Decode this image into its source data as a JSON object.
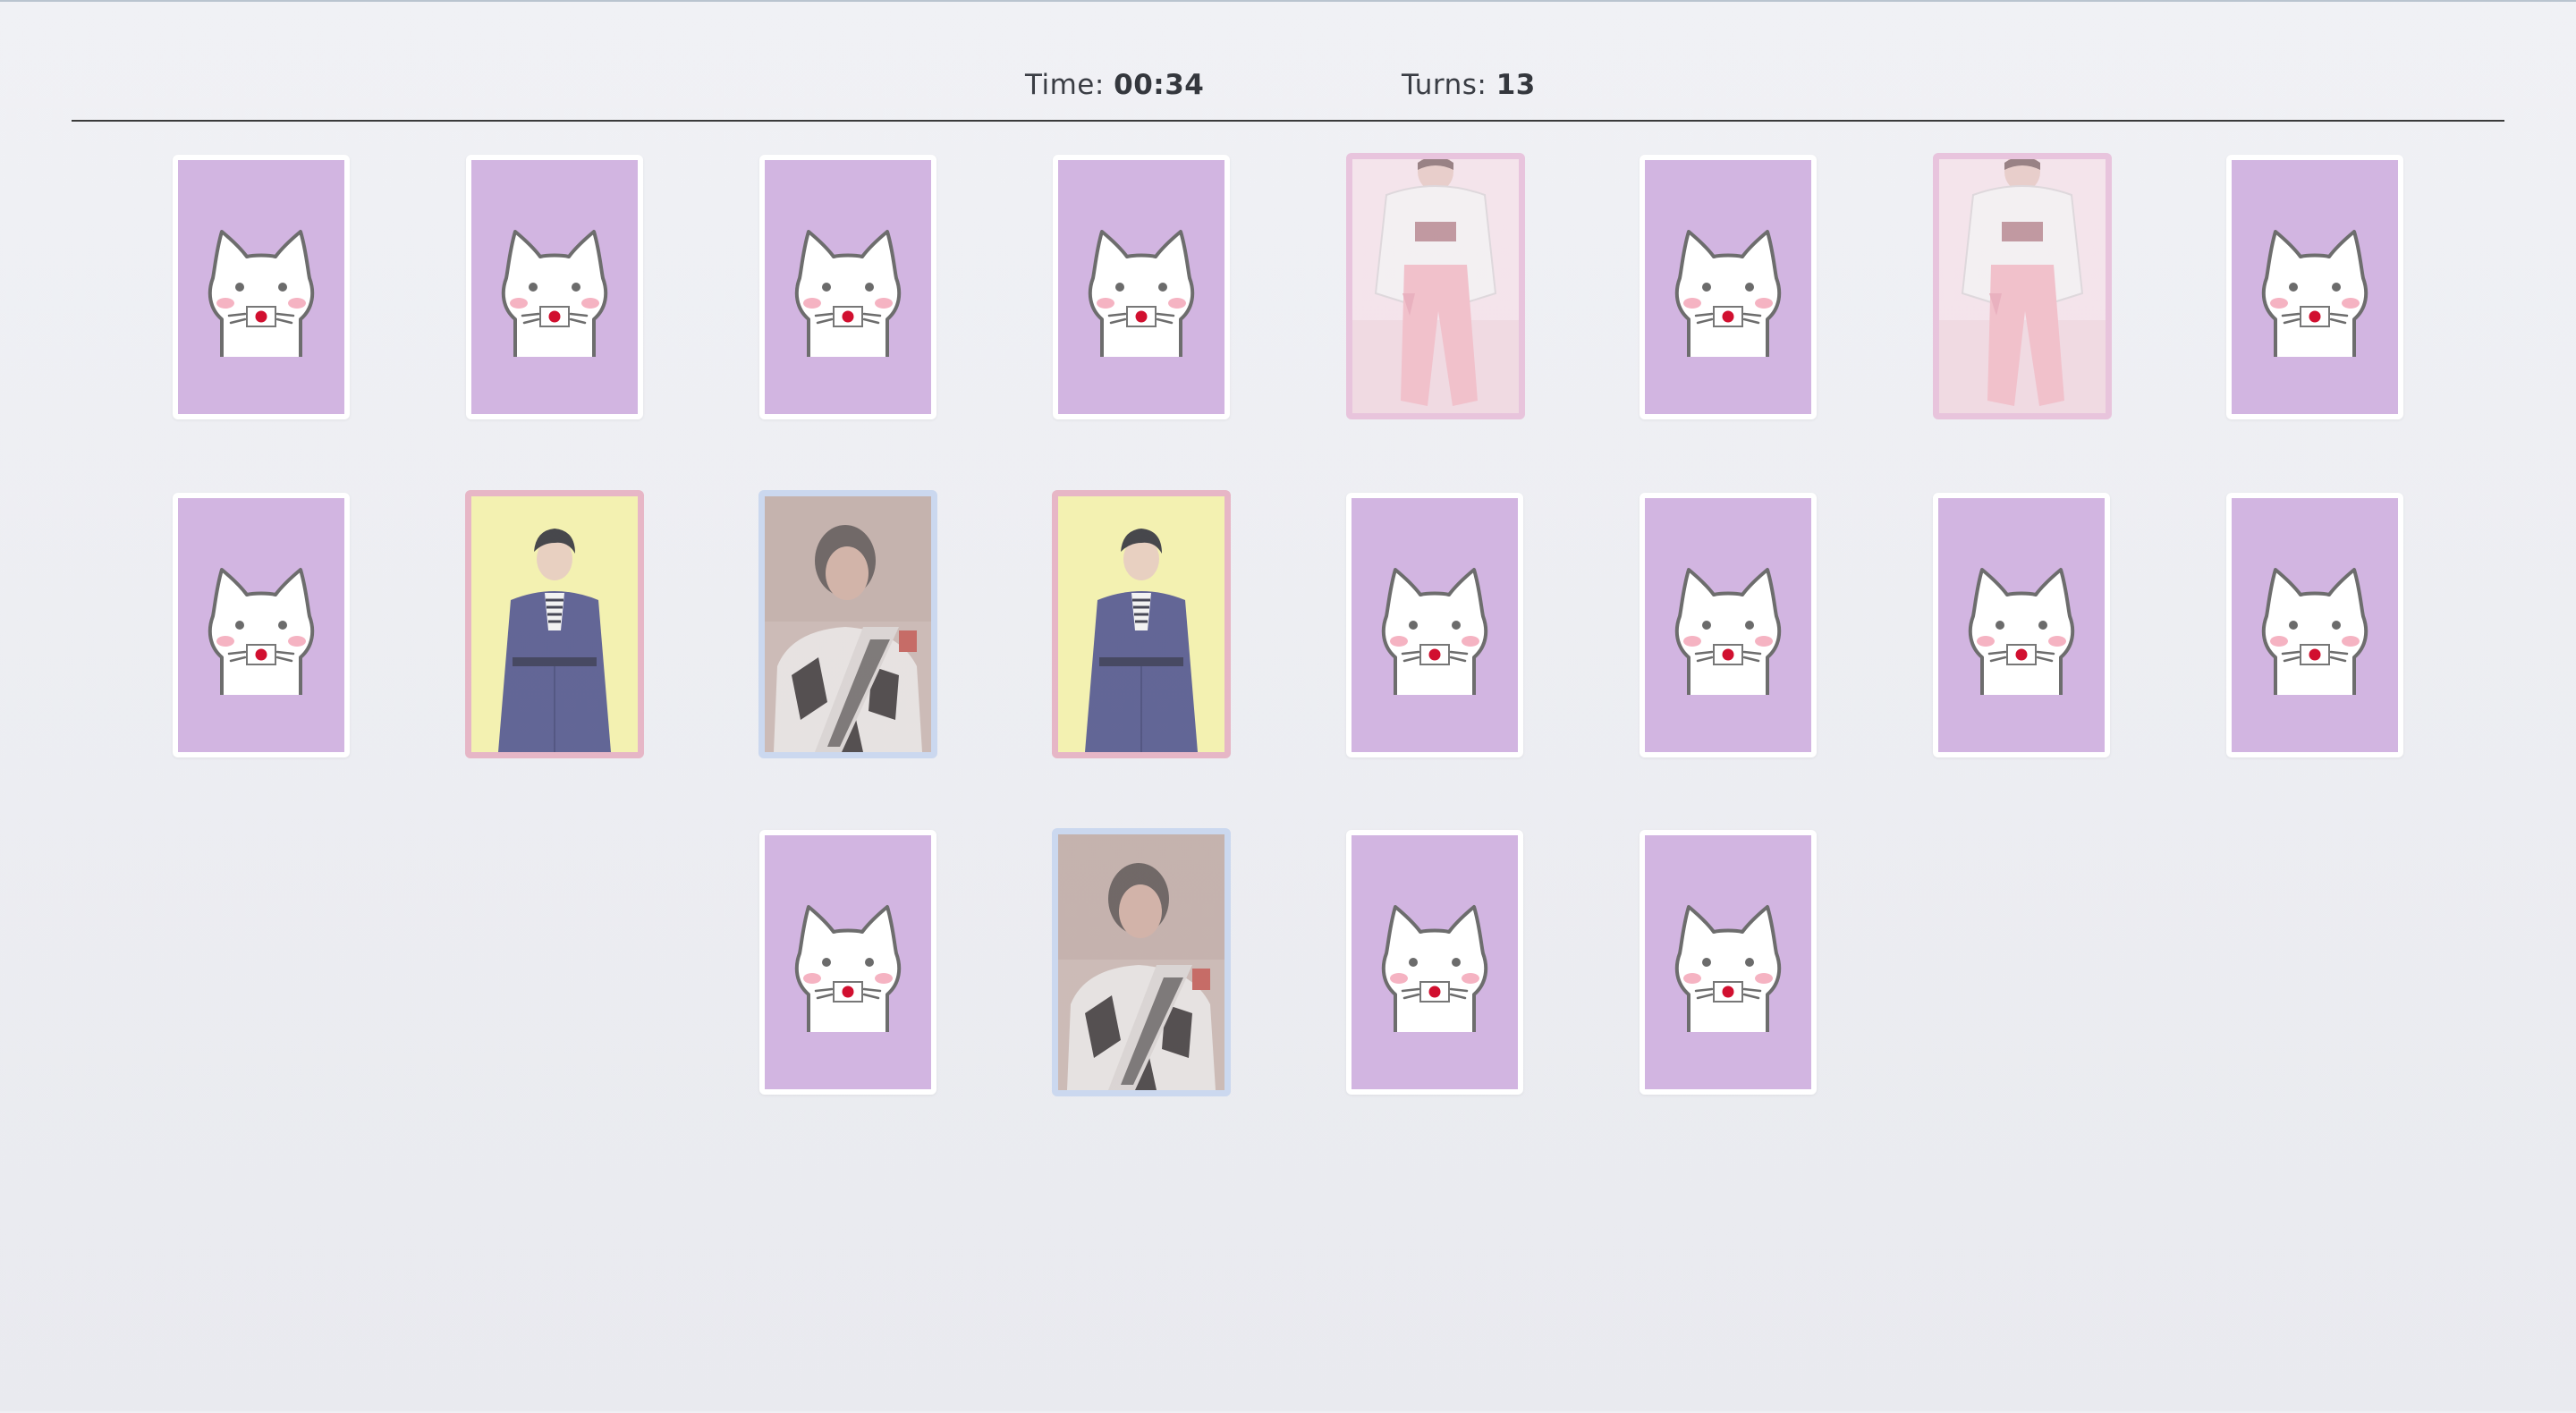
{
  "scoreboard": {
    "time_label": "Time:",
    "time_value": "00:34",
    "turns_label": "Turns:",
    "turns_value": "13"
  },
  "cards": [
    {
      "state": "hidden"
    },
    {
      "state": "hidden"
    },
    {
      "state": "hidden"
    },
    {
      "state": "hidden"
    },
    {
      "state": "revealed",
      "photo": "person-pink-outfit"
    },
    {
      "state": "hidden"
    },
    {
      "state": "revealed",
      "photo": "person-pink-outfit"
    },
    {
      "state": "hidden"
    },
    {
      "state": "hidden"
    },
    {
      "state": "revealed",
      "photo": "person-yellow-background"
    },
    {
      "state": "revealed",
      "photo": "person-patterned-jacket"
    },
    {
      "state": "revealed",
      "photo": "person-yellow-background"
    },
    {
      "state": "hidden"
    },
    {
      "state": "hidden"
    },
    {
      "state": "hidden"
    },
    {
      "state": "hidden"
    },
    {
      "state": "hidden"
    },
    {
      "state": "revealed",
      "photo": "person-patterned-jacket"
    },
    {
      "state": "hidden"
    },
    {
      "state": "hidden"
    }
  ],
  "colors": {
    "card_back": "#d2b5e1",
    "card_frame": "#ffffff",
    "match_pink": "#e7bdd9",
    "match_rose": "#e6adbf",
    "match_blue": "#c6d5ef",
    "divider": "#3b3b3b"
  },
  "icons": {
    "card_back": "cat-icon"
  }
}
